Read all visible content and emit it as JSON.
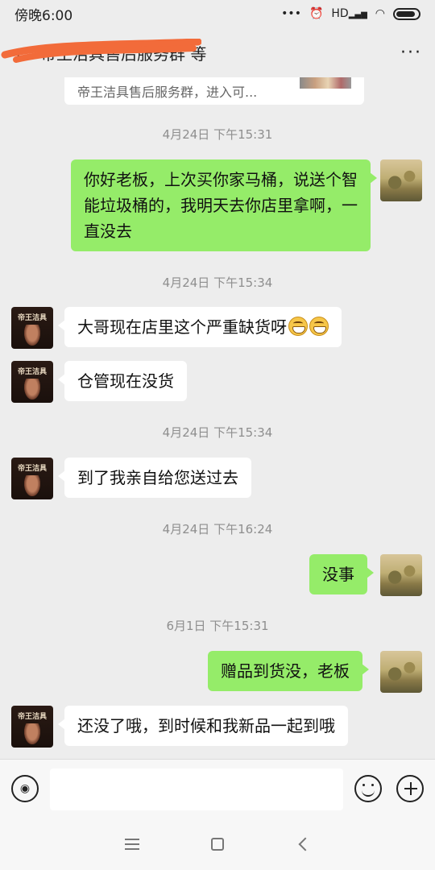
{
  "status_bar": {
    "time": "傍晚6:00",
    "icons": [
      "dots-icon",
      "alarm-icon",
      "signal-icon",
      "wifi-icon",
      "battery-icon"
    ],
    "network_badge": "HD"
  },
  "header": {
    "title": "帝王洁具售后服务群 等",
    "back_icon": "‹",
    "more_icon": "···"
  },
  "group_card": {
    "text": "帝王洁具售后服务群，进入可..."
  },
  "messages": [
    {
      "type": "time",
      "text": "4月24日 下午15:31"
    },
    {
      "type": "me",
      "text": "你好老板，上次买你家马桶，说送个智能垃圾桶的，我明天去你店里拿啊，一直没去"
    },
    {
      "type": "time",
      "text": "4月24日 下午15:34"
    },
    {
      "type": "other",
      "text": "大哥现在店里这个严重缺货呀",
      "emoji": [
        "grin-emoji",
        "grin-emoji"
      ]
    },
    {
      "type": "other",
      "text": "仓管现在没货"
    },
    {
      "type": "time",
      "text": "4月24日 下午15:34"
    },
    {
      "type": "other",
      "text": "到了我亲自给您送过去"
    },
    {
      "type": "time",
      "text": "4月24日 下午16:24"
    },
    {
      "type": "me",
      "text": "没事"
    },
    {
      "type": "time",
      "text": "6月1日 下午15:31"
    },
    {
      "type": "me",
      "text": "赠品到货没，老板"
    },
    {
      "type": "other",
      "text": "还没了哦，到时候和我新品一起到哦"
    }
  ],
  "avatar_shop": {
    "brand": "帝王洁具"
  },
  "input_bar": {
    "voice_icon": "voice-icon",
    "emoji_icon": "emoji-icon",
    "plus_icon": "plus-icon",
    "placeholder": ""
  },
  "nav_bar": {
    "icons": [
      "menu-icon",
      "home-icon",
      "back-icon"
    ]
  },
  "colors": {
    "my_bubble": "#95ec69",
    "other_bubble": "#ffffff",
    "background": "#ededed"
  }
}
